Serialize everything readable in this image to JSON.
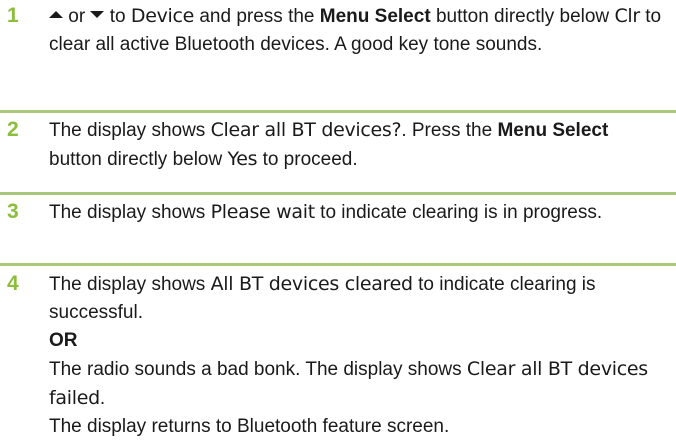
{
  "colors": {
    "step_number": "#8cbd3c",
    "separator": "#a9c77a",
    "text": "#1a1a1a"
  },
  "icons": {
    "up": "up-triangle-icon",
    "down": "down-triangle-icon"
  },
  "steps": [
    {
      "number": "1",
      "or_word": "or",
      "to_word": "to",
      "device": "Device",
      "and_press": "and press the",
      "menu_select": "Menu Select",
      "button_below": "button directly below",
      "clr": "Clr",
      "rest": "to clear all active Bluetooth devices. A good key tone sounds."
    },
    {
      "number": "2",
      "display_shows": "The display shows",
      "clear_all": "Clear all BT devices?",
      "press_the": ". Press the",
      "menu_select": "Menu Select",
      "button_below": "button directly below",
      "yes": "Yes",
      "to_proceed": "to proceed."
    },
    {
      "number": "3",
      "display_shows": "The display shows",
      "please_wait": "Please wait",
      "rest": "to indicate clearing is in progress."
    },
    {
      "number": "4",
      "display_shows": "The display shows",
      "all_cleared": "All BT devices cleared",
      "rest": "to indicate clearing is successful.",
      "or_label": "OR",
      "bonk_text": "The radio sounds a bad bonk. The display shows",
      "failed": "Clear all BT devices failed",
      "period": ".",
      "returns": "The display returns to Bluetooth feature screen."
    }
  ]
}
